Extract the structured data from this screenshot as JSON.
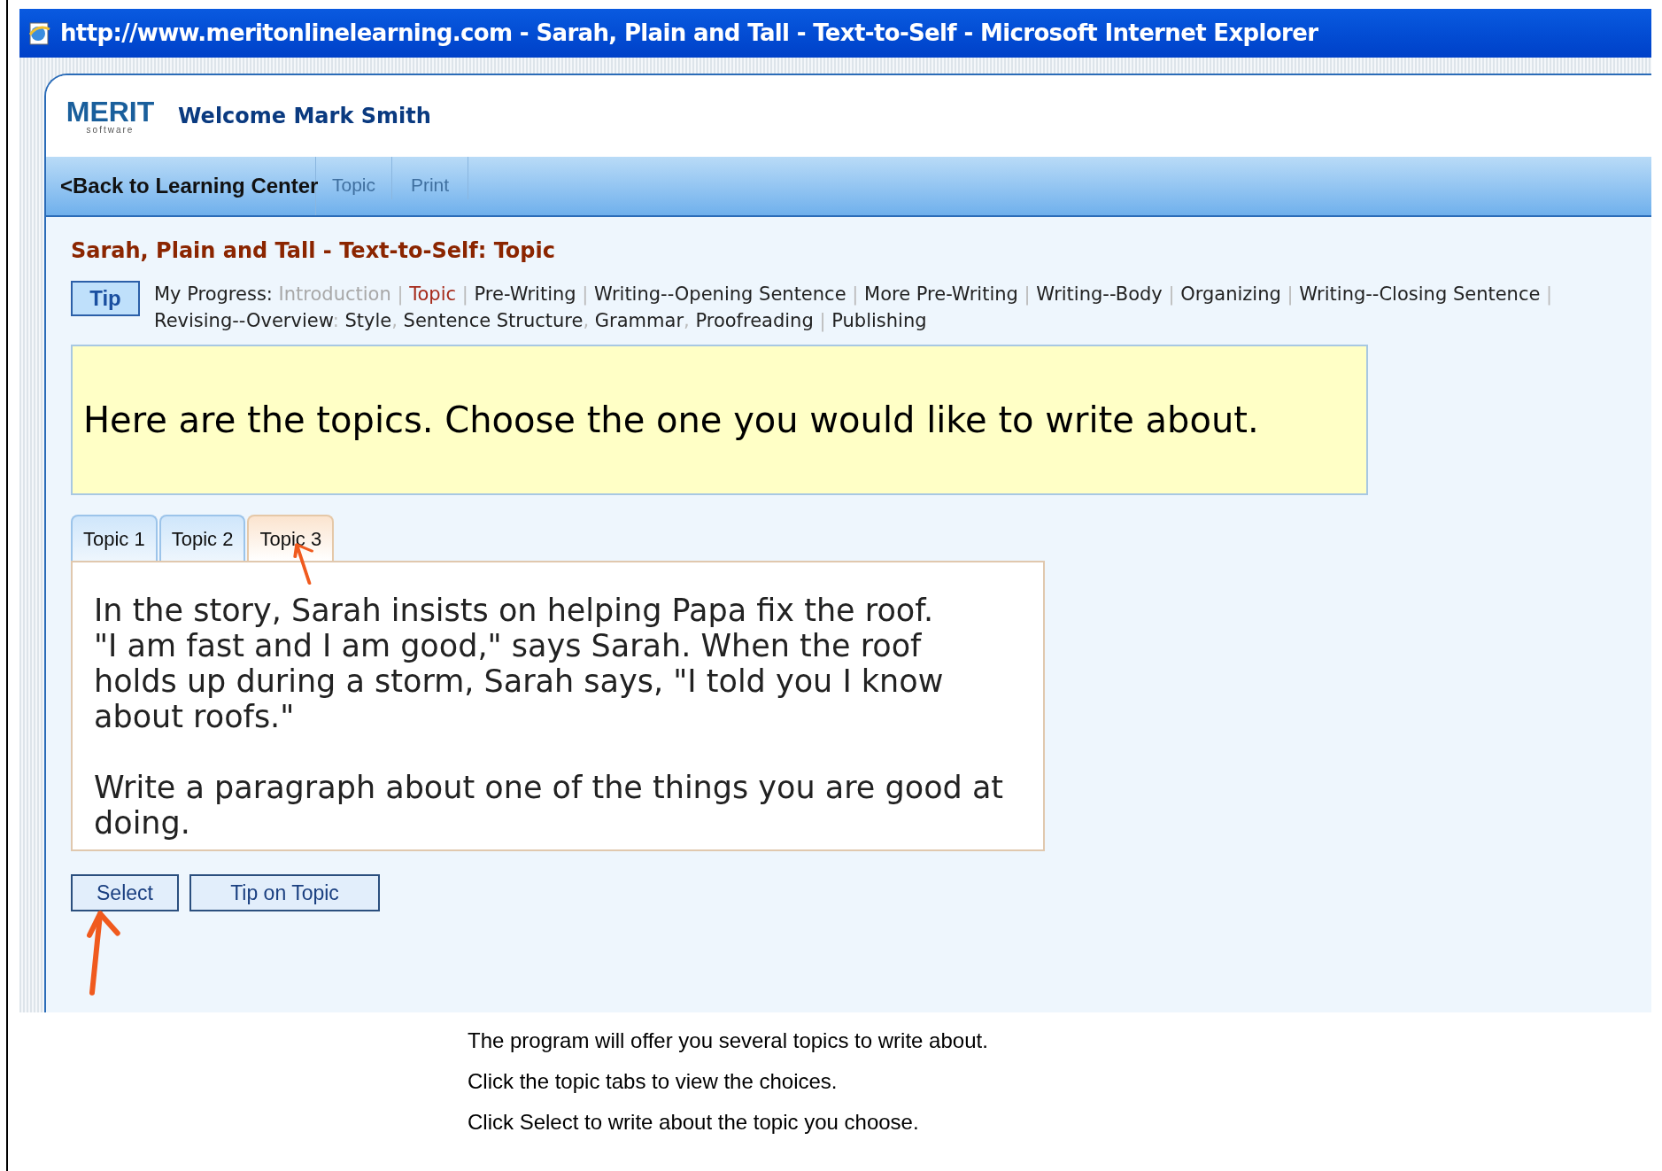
{
  "window": {
    "title": "http://www.meritonlinelearning.com - Sarah, Plain and Tall - Text-to-Self - Microsoft Internet Explorer"
  },
  "header": {
    "logo": "MERIT",
    "logo_sub": "software",
    "welcome": "Welcome Mark Smith"
  },
  "nav": [
    {
      "label": "<Back to Learning Center",
      "disabled": false
    },
    {
      "label": "Topic",
      "disabled": true
    },
    {
      "label": "Print",
      "disabled": true
    }
  ],
  "page_title": "Sarah, Plain and Tall - Text-to-Self: Topic",
  "tip_button": "Tip",
  "progress": {
    "label": "My Progress:",
    "steps": [
      {
        "label": "Introduction",
        "visited": true,
        "current": false,
        "separator": "|"
      },
      {
        "label": "Topic",
        "visited": false,
        "current": true,
        "separator": "|"
      },
      {
        "label": "Pre-Writing",
        "visited": false,
        "current": false,
        "separator": "|"
      },
      {
        "label": "Writing--Opening Sentence",
        "visited": false,
        "current": false,
        "separator": "|"
      },
      {
        "label": "More Pre-Writing",
        "visited": false,
        "current": false,
        "separator": "|"
      },
      {
        "label": "Writing--Body",
        "visited": false,
        "current": false,
        "separator": "|"
      },
      {
        "label": "Organizing",
        "visited": false,
        "current": false,
        "separator": "|"
      },
      {
        "label": "Writing--Closing Sentence",
        "visited": false,
        "current": false,
        "separator": "|"
      },
      {
        "label": "Revising--Overview",
        "visited": false,
        "current": false,
        "separator": ":"
      },
      {
        "label": "Style",
        "visited": false,
        "current": false,
        "separator": ","
      },
      {
        "label": "Sentence Structure",
        "visited": false,
        "current": false,
        "separator": ","
      },
      {
        "label": "Grammar",
        "visited": false,
        "current": false,
        "separator": ","
      },
      {
        "label": "Proofreading",
        "visited": false,
        "current": false,
        "separator": "|"
      },
      {
        "label": "Publishing",
        "visited": false,
        "current": false
      }
    ]
  },
  "instruction": "Here are the topics. Choose the one you would like to write about.",
  "topic_tabs": [
    {
      "label": "Topic 1",
      "selected": false
    },
    {
      "label": "Topic 2",
      "selected": false
    },
    {
      "label": "Topic 3",
      "selected": true
    }
  ],
  "topic_text": [
    "In the story, Sarah insists on helping Papa fix the roof. \"I am fast and I am good,\" says Sarah. When the roof holds up during a storm, Sarah says, \"I told you I know about roofs.\"",
    "Write a paragraph about one of the things you are good at doing."
  ],
  "buttons": [
    "Select",
    "Tip on Topic"
  ],
  "caption": [
    "The program will offer you several topics to write about.",
    "Click the topic tabs to view the choices.",
    "Click Select to write about the topic you choose."
  ]
}
